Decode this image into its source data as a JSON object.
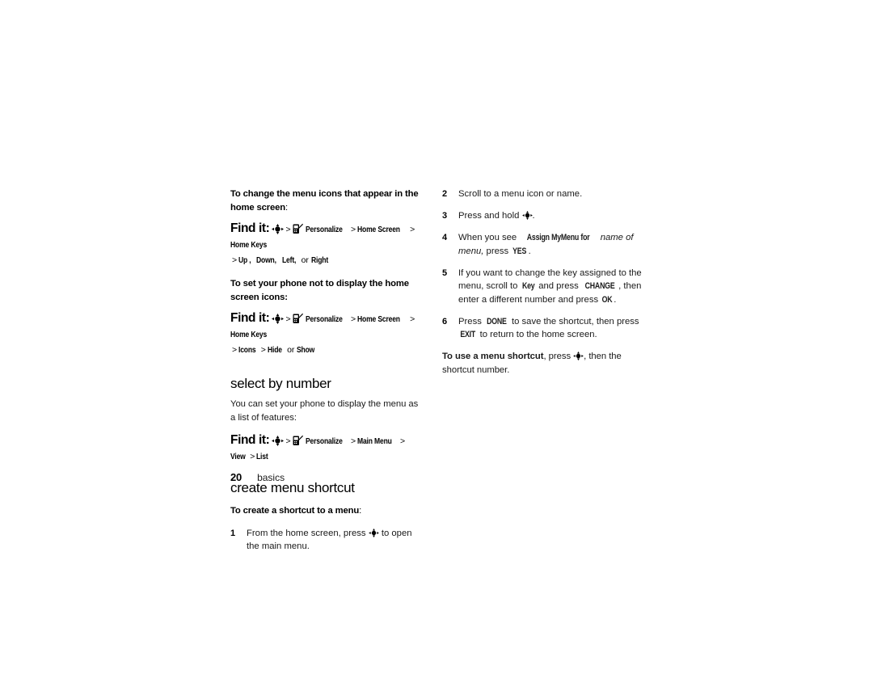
{
  "page": {
    "folio_number": "20",
    "folio_label": "basics"
  },
  "icons": {
    "nav_key": "navigation-center-key-icon",
    "personalize": "personalize-phone-icon"
  },
  "left_column": {
    "block1": {
      "lead_bold": "To change the menu icons that appear in the home screen",
      "lead_colon": ":",
      "findit_label": "Find it:",
      "path_items": [
        "Personalize",
        "Home Screen",
        "Home Keys"
      ],
      "path_continued_prefix": ">",
      "path_continued": [
        "Up ,",
        "Down,",
        "Left,"
      ],
      "path_continued_or": "or",
      "path_continued_last": "Right"
    },
    "block2": {
      "lead_bold": "To set your phone not to display the home screen icons:",
      "findit_label": "Find it:",
      "path_items": [
        "Personalize",
        "Home Screen",
        "Home Keys"
      ],
      "path_continued_prefix": ">",
      "path_continued_first": "Icons",
      "path_continued_sep": ">",
      "path_continued_second": "Hide",
      "path_continued_or": "or",
      "path_continued_third": "Show"
    },
    "section1": {
      "heading": "select by number",
      "body": "You can set your phone to display the menu as a list of features:",
      "findit_label": "Find it:",
      "path_items": [
        "Personalize",
        "Main Menu",
        "View",
        "List"
      ]
    },
    "section2": {
      "heading": "create menu shortcut",
      "sub_bold": "To create a shortcut to a menu",
      "sub_colon": ":",
      "step1": {
        "num": "1",
        "text_before": "From the home screen, press",
        "text_after": "to open the main menu."
      }
    }
  },
  "right_column": {
    "steps": [
      {
        "num": "2",
        "text": "Scroll to a menu icon or name."
      },
      {
        "num": "3",
        "text_before": "Press and hold",
        "text_after": "."
      },
      {
        "num": "4",
        "text_before": "When you see",
        "key1": "Assign MyMenu for",
        "italic": "name of menu,",
        "text_mid": "press",
        "key2": "YES",
        "text_after": "."
      },
      {
        "num": "5",
        "text_before": "If you want to change the key assigned to the menu, scroll to",
        "key1": "Key",
        "text_mid1": "and press",
        "key2": "CHANGE",
        "text_mid2": ", then enter a different number and press",
        "key3": "OK",
        "text_after": "."
      },
      {
        "num": "6",
        "text_before": "Press",
        "key1": "DONE",
        "text_mid1": "to save the shortcut, then press",
        "key2": "EXIT",
        "text_after": "to return to the home screen."
      }
    ],
    "closing": {
      "bold": "To use a menu shortcut",
      "text_before": ", press",
      "text_after": ", then the shortcut number."
    }
  }
}
